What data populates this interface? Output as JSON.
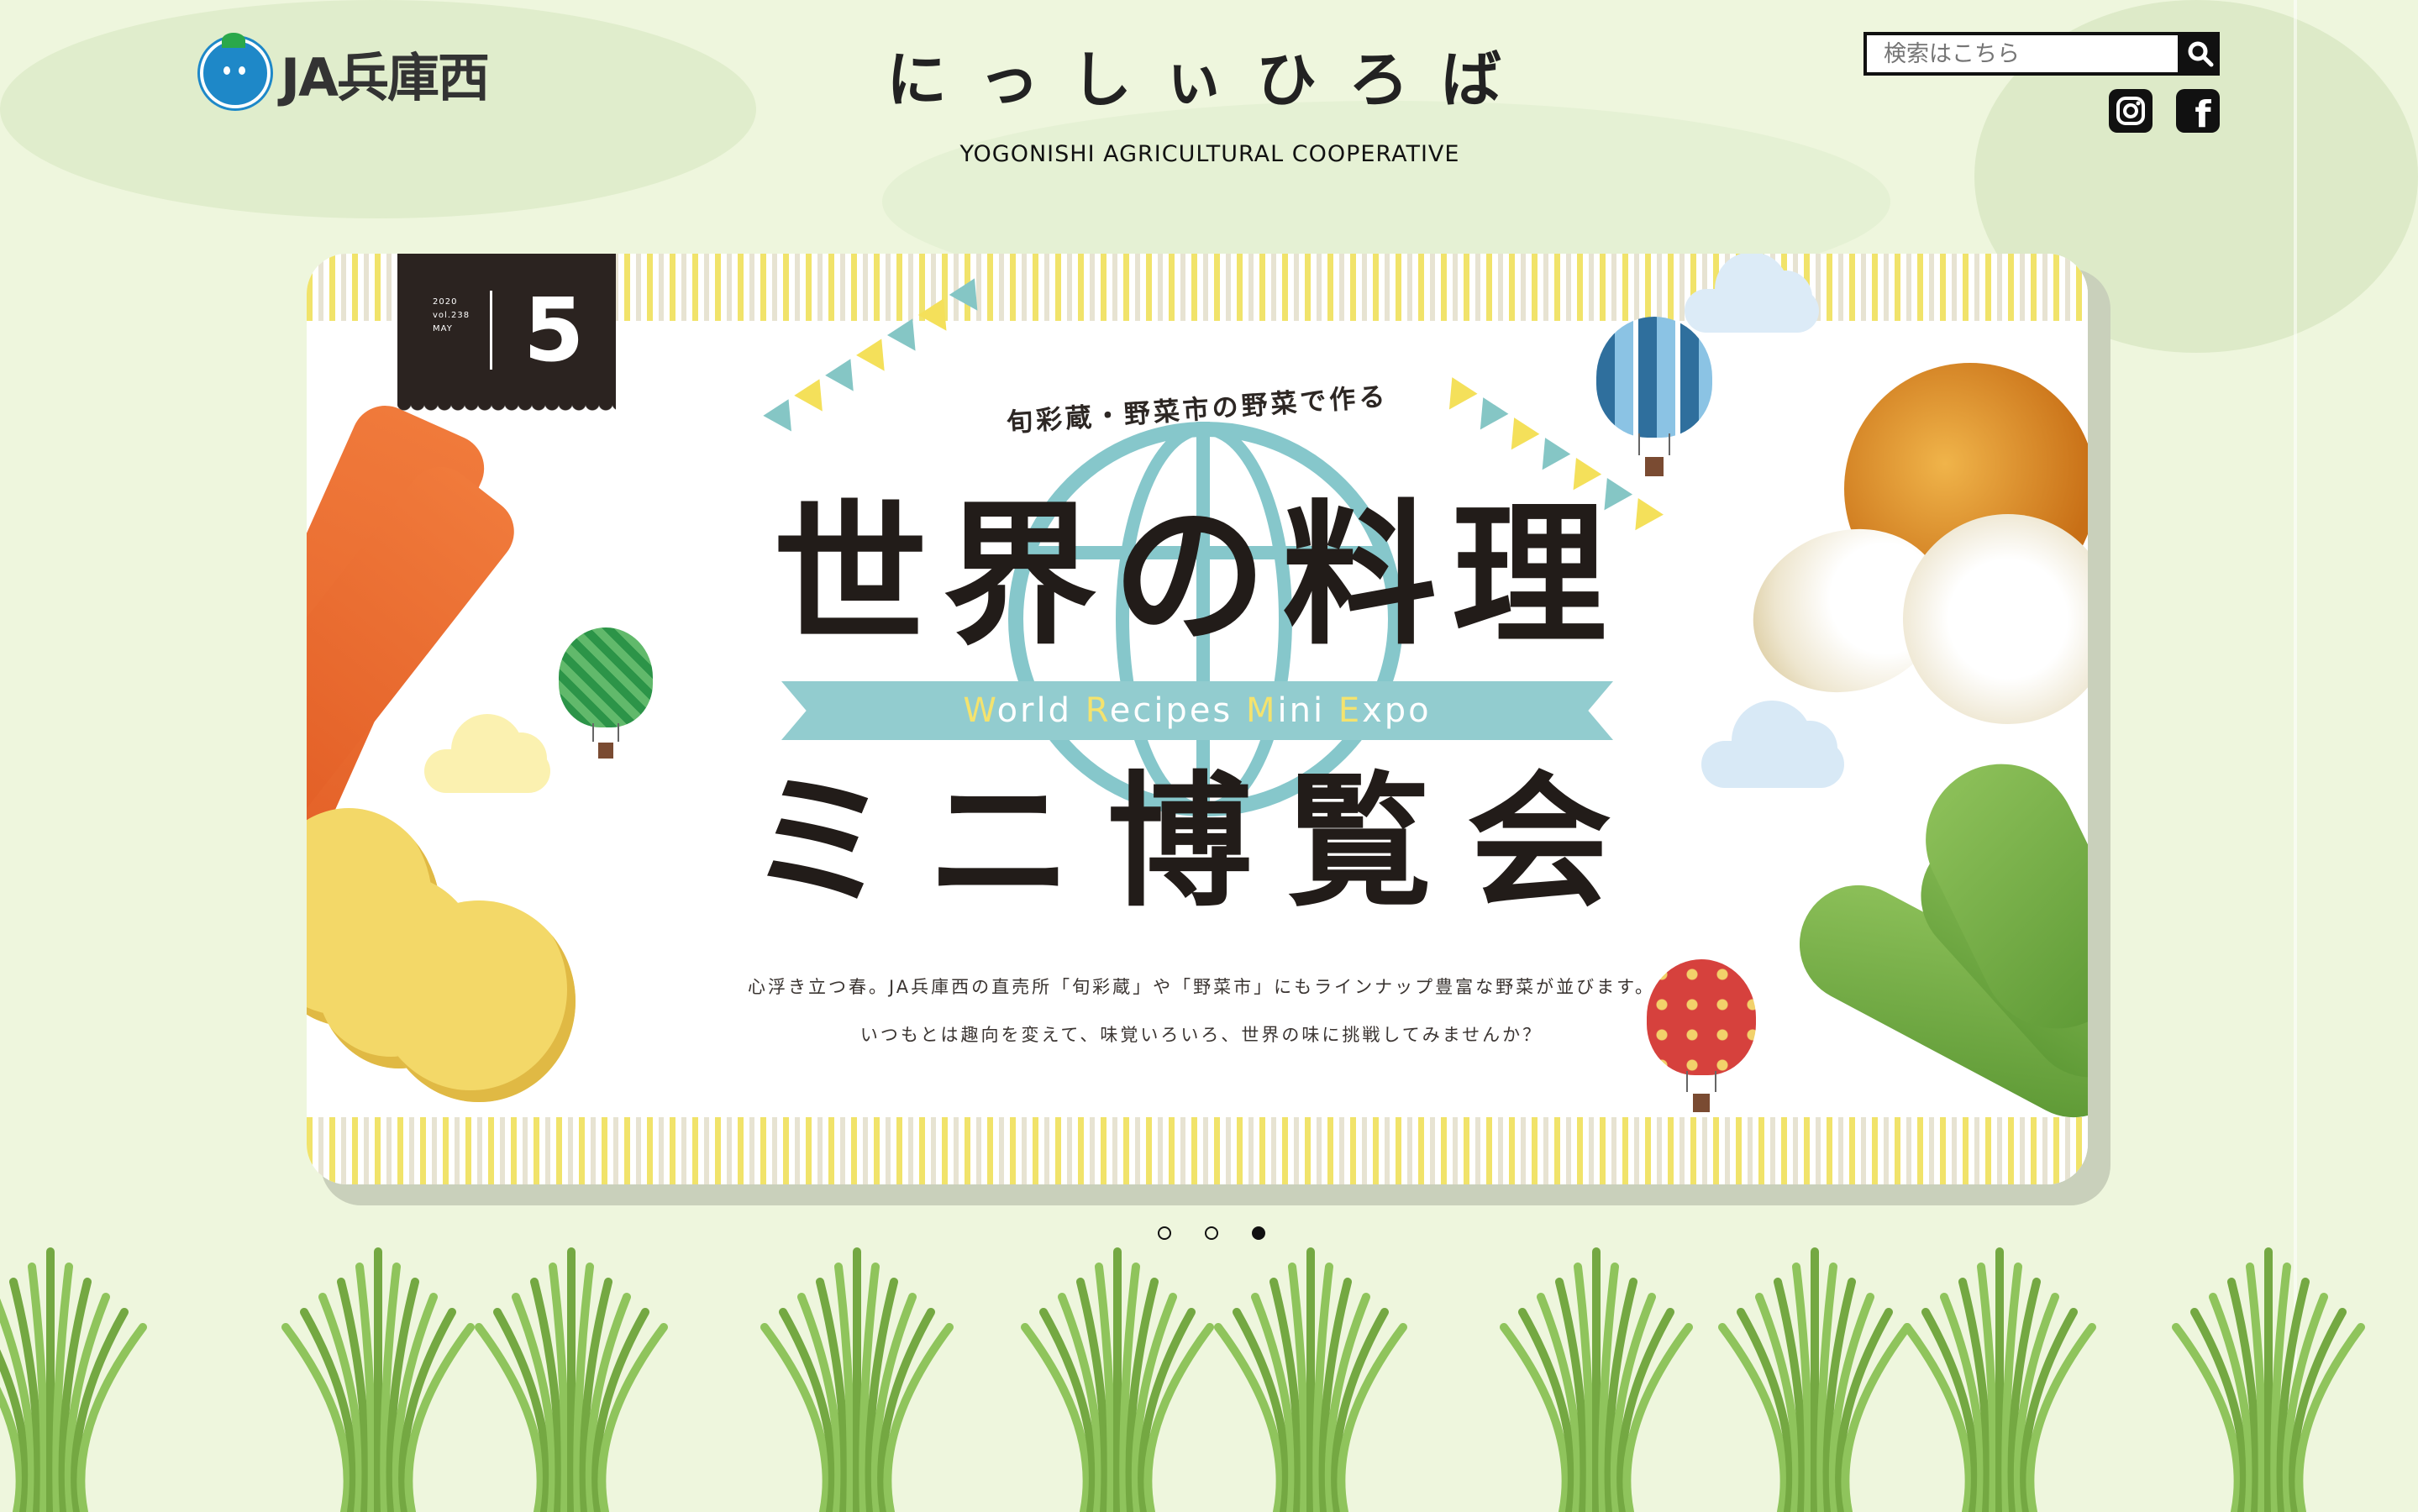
{
  "header": {
    "logo_text": "JA兵庫西",
    "site_title": "にっしぃひろば",
    "site_subtitle": "YOGONISHI AGRICULTURAL COOPERATIVE"
  },
  "search": {
    "placeholder": "検索はこちら",
    "button_icon": "search-icon"
  },
  "social": {
    "instagram_icon": "instagram-icon",
    "facebook_icon": "facebook-icon"
  },
  "banner": {
    "issue": {
      "year": "2020",
      "volume": "vol.238",
      "month_label": "MAY",
      "month_number": "5"
    },
    "kicker": "旬彩蔵・野菜市の野菜で作る",
    "headline_main": "世界の料理",
    "ribbon": {
      "w": "W",
      "world": "orld ",
      "r": "R",
      "recipes": "ecipes ",
      "m": "M",
      "mini": "ini ",
      "e": "E",
      "expo": "xpo"
    },
    "headline_sub": "ミニ博覧会",
    "description_1": "心浮き立つ春。JA兵庫西の直売所「旬彩蔵」や「野菜市」にもラインナップ豊富な野菜が並びます。",
    "description_2": "いつもとは趣向を変えて、味覚いろいろ、世界の味に挑戦してみませんか？"
  },
  "carousel": {
    "total": 3,
    "active_index": 2
  },
  "colors": {
    "page_background": "#eef6dd",
    "accent_teal": "#92cccf",
    "accent_yellow": "#f4e36e",
    "text_dark": "#221c19"
  }
}
